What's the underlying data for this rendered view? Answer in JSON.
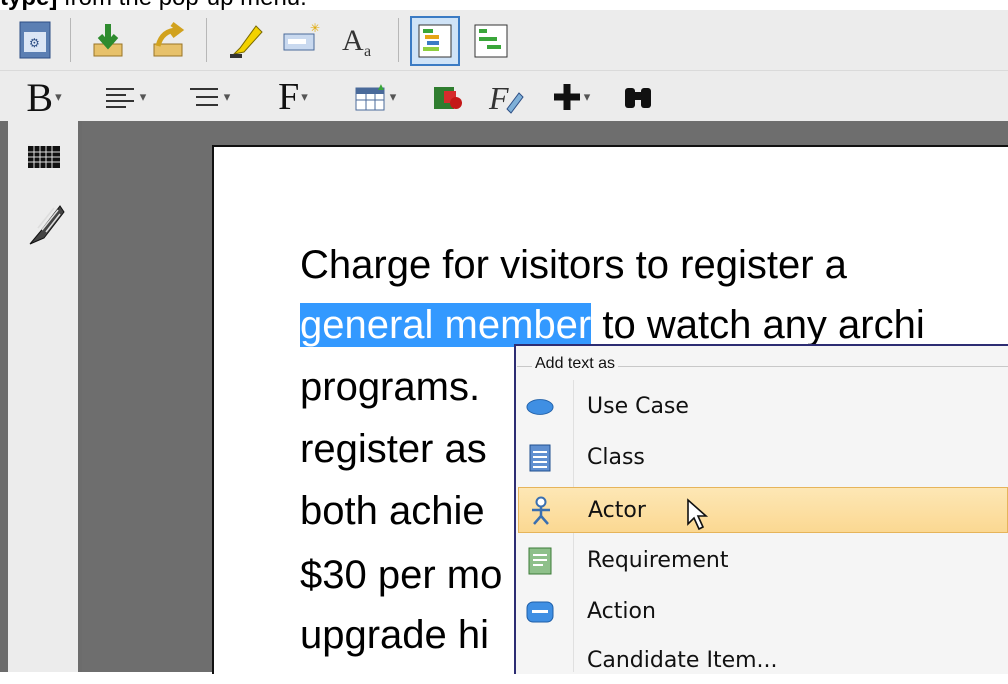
{
  "caption": {
    "bold_fragment": "type]",
    "rest": " from the pop-up menu."
  },
  "toolbar1": {
    "icons": [
      "report-icon",
      "import-icon",
      "export-icon",
      "highlighter-icon",
      "insert-field-icon",
      "font-size-icon",
      "layout-a-icon",
      "layout-b-icon"
    ]
  },
  "toolbar2": {
    "icons": [
      "bold-icon",
      "align-icon",
      "list-icon",
      "font-icon",
      "table-icon",
      "color-icon",
      "formula-icon",
      "add-icon",
      "find-icon"
    ],
    "bold_glyph": "B",
    "font_glyph": "F"
  },
  "document": {
    "lines": [
      {
        "pre": "",
        "highlighted": "",
        "post": "Charge for visitors to register a"
      },
      {
        "pre": "",
        "highlighted": "general member",
        "post": " to watch any archi"
      },
      {
        "pre": "",
        "highlighted": "",
        "post": "programs."
      },
      {
        "pre": "",
        "highlighted": "",
        "post": "register as"
      },
      {
        "pre": "",
        "highlighted": "",
        "post": "both achie"
      },
      {
        "pre": "",
        "highlighted": "",
        "post": "$30 per mo"
      },
      {
        "pre": "",
        "highlighted": "",
        "post": "upgrade hi"
      }
    ]
  },
  "context_menu": {
    "header": "Add text as",
    "items": [
      {
        "label": "Use Case",
        "icon": "use-case-icon"
      },
      {
        "label": "Class",
        "icon": "class-icon"
      },
      {
        "label": "Actor",
        "icon": "actor-icon",
        "hovered": true
      },
      {
        "label": "Requirement",
        "icon": "requirement-icon"
      },
      {
        "label": "Action",
        "icon": "action-icon"
      },
      {
        "label": "Candidate Item...",
        "icon": ""
      }
    ]
  },
  "colors": {
    "highlight": "#3399ff",
    "menu_hover": "#fbd892",
    "panel_gray": "#6e6e6e"
  }
}
